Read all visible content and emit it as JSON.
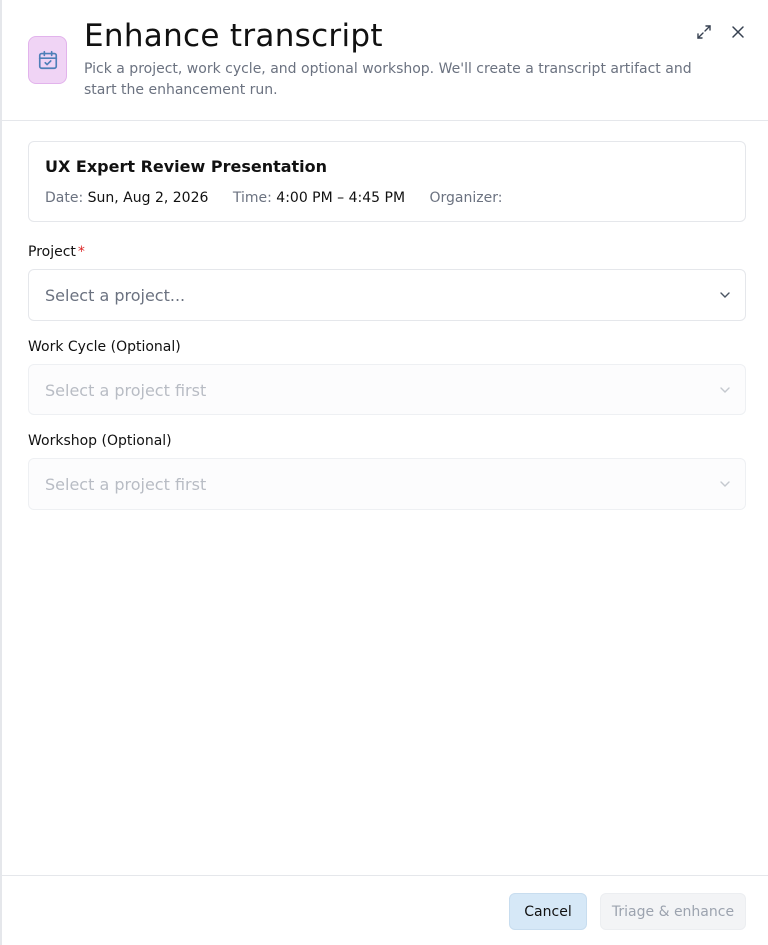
{
  "header": {
    "icon": "calendar-check-icon",
    "title": "Enhance transcript",
    "subtitle": "Pick a project, work cycle, and optional workshop. We'll create a transcript artifact and start the enhancement run.",
    "expand_icon": "expand-icon",
    "close_icon": "close-icon"
  },
  "meeting": {
    "title": "UX Expert Review Presentation",
    "date_label": "Date:",
    "date_value": "Sun, Aug 2, 2026",
    "time_label": "Time:",
    "time_value": "4:00 PM – 4:45 PM",
    "organizer_label": "Organizer:",
    "organizer_value": ""
  },
  "form": {
    "project": {
      "label": "Project",
      "required_mark": "*",
      "placeholder": "Select a project..."
    },
    "work_cycle": {
      "label": "Work Cycle (Optional)",
      "placeholder": "Select a project first"
    },
    "workshop": {
      "label": "Workshop (Optional)",
      "placeholder": "Select a project first"
    }
  },
  "footer": {
    "cancel_label": "Cancel",
    "submit_label": "Triage & enhance"
  },
  "colors": {
    "icon_bg": "#f0d4f5",
    "cancel_bg": "#d6e8f7",
    "required": "#dc2626"
  }
}
